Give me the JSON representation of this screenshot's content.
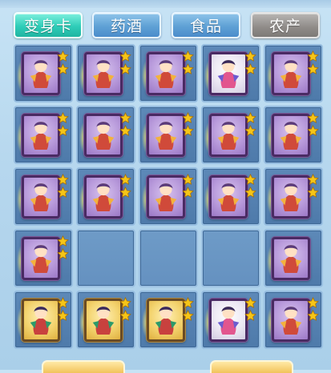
{
  "tabs": [
    {
      "label": "变身卡",
      "state": "active"
    },
    {
      "label": "药酒",
      "state": "inactive"
    },
    {
      "label": "食品",
      "state": "inactive"
    },
    {
      "label": "农产",
      "state": "special"
    }
  ],
  "colors": {
    "active_tab": "#2fcdb8",
    "inactive_tab": "#5fa1d5",
    "special_tab": "#8f8b88",
    "cell_bg": "#4e7aaa",
    "star": "#f5c518"
  },
  "grid": {
    "rows": 5,
    "cols": 5,
    "cells": [
      {
        "item": "card-lion-icon",
        "tint": "purple",
        "stars": 2
      },
      {
        "item": "card-fox-warrior-icon",
        "tint": "purple",
        "stars": 2
      },
      {
        "item": "card-fox-warrior-icon",
        "tint": "purple",
        "stars": 2
      },
      {
        "item": "card-girl-icon",
        "tint": "white",
        "stars": 2
      },
      {
        "item": "card-fairy-icon",
        "tint": "purple",
        "stars": 2
      },
      {
        "item": "card-spider-icon",
        "tint": "purple",
        "stars": 2
      },
      {
        "item": "card-spider-icon",
        "tint": "purple",
        "stars": 2
      },
      {
        "item": "card-wizard-icon",
        "tint": "purple",
        "stars": 2
      },
      {
        "item": "card-monkey-icon",
        "tint": "purple",
        "stars": 2
      },
      {
        "item": "card-mermaid-icon",
        "tint": "purple",
        "stars": 2
      },
      {
        "item": "card-phoenix-icon",
        "tint": "purple",
        "stars": 2
      },
      {
        "item": "card-phoenix-icon",
        "tint": "purple",
        "stars": 2
      },
      {
        "item": "card-bat-demon-icon",
        "tint": "purple",
        "stars": 2
      },
      {
        "item": "card-bat-demon-icon",
        "tint": "purple",
        "stars": 2
      },
      {
        "item": "card-bat-demon-icon",
        "tint": "purple",
        "stars": 2
      },
      {
        "item": "card-ninja-icon",
        "tint": "purple",
        "stars": 2
      },
      {
        "item": null
      },
      {
        "item": null
      },
      {
        "item": null
      },
      {
        "item": "card-bee-icon",
        "tint": "purple",
        "stars": 0
      },
      {
        "item": "card-dancer-icon",
        "tint": "gold",
        "stars": 2
      },
      {
        "item": "card-rabbit-icon",
        "tint": "gold",
        "stars": 2
      },
      {
        "item": "card-rabbit-icon",
        "tint": "gold",
        "stars": 2
      },
      {
        "item": "card-knight-icon",
        "tint": "white",
        "stars": 2
      },
      {
        "item": "card-bat-demon-icon",
        "tint": "purple",
        "stars": 2
      }
    ]
  }
}
